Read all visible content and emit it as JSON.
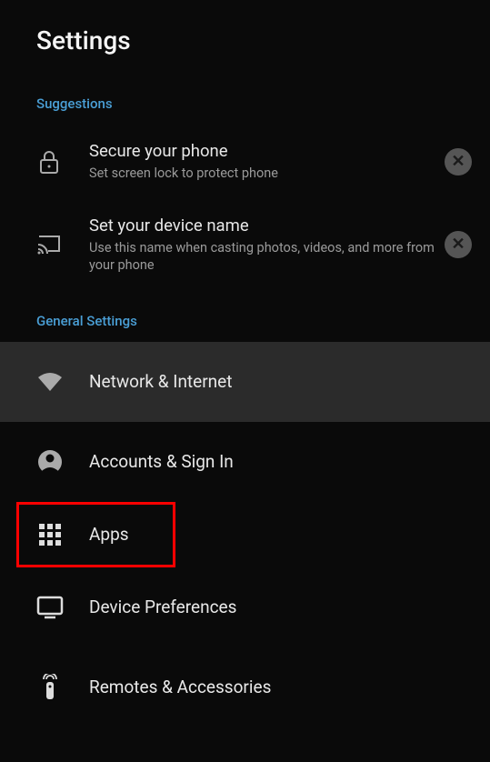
{
  "header": {
    "title": "Settings"
  },
  "sections": {
    "suggestions_header": "Suggestions",
    "general_header": "General Settings"
  },
  "suggestions": {
    "secure": {
      "title": "Secure your phone",
      "desc": "Set screen lock to protect phone"
    },
    "device_name": {
      "title": "Set your device name",
      "desc": "Use this name when casting photos, videos, and more from your phone"
    }
  },
  "settings": {
    "network": "Network & Internet",
    "accounts": "Accounts & Sign In",
    "apps": "Apps",
    "device_prefs": "Device Preferences",
    "remotes": "Remotes & Accessories"
  }
}
